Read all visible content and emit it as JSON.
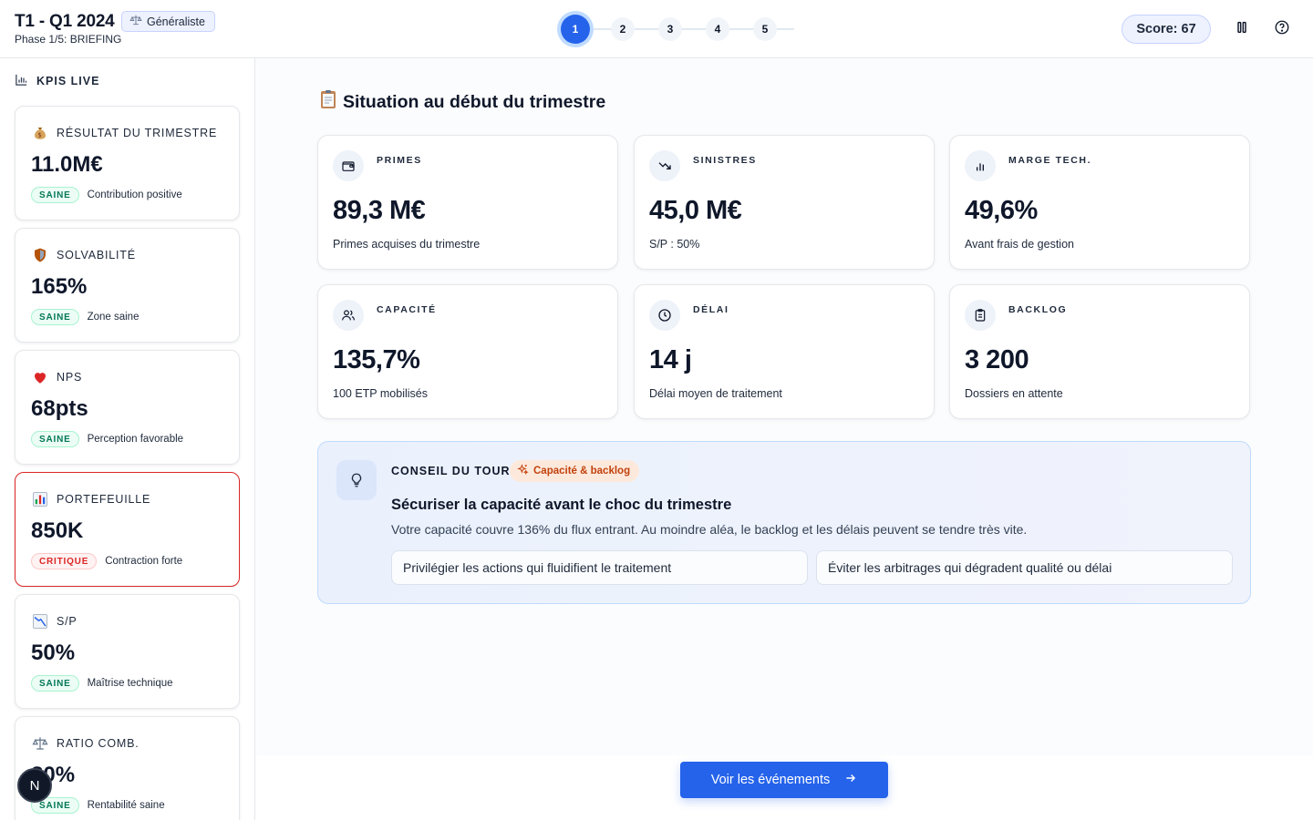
{
  "header": {
    "title": "T1 - Q1 2024",
    "profile_badge": "Généraliste",
    "phase": "Phase 1/5: BRIEFING",
    "steps": [
      "1",
      "2",
      "3",
      "4",
      "5"
    ],
    "active_step": 1,
    "score": "Score: 67"
  },
  "sidebar": {
    "title": "KPIS LIVE",
    "kpis": [
      {
        "icon": "money-bag-icon",
        "label": "RÉSULTAT DU TRIMESTRE",
        "value": "11.0M€",
        "status": "SAINE",
        "note": "Contribution positive"
      },
      {
        "icon": "shield-icon",
        "label": "SOLVABILITÉ",
        "value": "165%",
        "status": "SAINE",
        "note": "Zone saine"
      },
      {
        "icon": "heart-icon",
        "label": "NPS",
        "value": "68pts",
        "status": "SAINE",
        "note": "Perception favorable"
      },
      {
        "icon": "bar-chart-icon",
        "label": "PORTEFEUILLE",
        "value": "850K",
        "status": "CRITIQUE",
        "note": "Contraction forte"
      },
      {
        "icon": "chart-down-icon",
        "label": "S/P",
        "value": "50%",
        "status": "SAINE",
        "note": "Maîtrise technique"
      },
      {
        "icon": "balance-scale-icon",
        "label": "RATIO COMB.",
        "value": "80%",
        "status": "SAINE",
        "note": "Rentabilité saine"
      }
    ],
    "avatar_initial": "N"
  },
  "main": {
    "section_title": "Situation au début du trimestre",
    "metrics": [
      {
        "icon": "wallet-icon",
        "label": "PRIMES",
        "value": "89,3 M€",
        "sub": "Primes acquises du trimestre"
      },
      {
        "icon": "trend-down-icon",
        "label": "SINISTRES",
        "value": "45,0 M€",
        "sub": "S/P : 50%"
      },
      {
        "icon": "bar-chart-icon",
        "label": "MARGE TECH.",
        "value": "49,6%",
        "sub": "Avant frais de gestion"
      },
      {
        "icon": "users-icon",
        "label": "CAPACITÉ",
        "value": "135,7%",
        "sub": "100 ETP mobilisés"
      },
      {
        "icon": "clock-icon",
        "label": "DÉLAI",
        "value": "14 j",
        "sub": "Délai moyen de traitement"
      },
      {
        "icon": "clipboard-icon",
        "label": "BACKLOG",
        "value": "3 200",
        "sub": "Dossiers en attente"
      }
    ],
    "advice": {
      "label": "CONSEIL DU TOUR",
      "tag": "Capacité & backlog",
      "headline": "Sécuriser la capacité avant le choc du trimestre",
      "text": "Votre capacité couvre 136% du flux entrant. Au moindre aléa, le backlog et les délais peuvent se tendre très vite.",
      "pills": [
        "Privilégier les actions qui fluidifient le traitement",
        "Éviter les arbitrages qui dégradent qualité ou délai"
      ]
    },
    "cta": "Voir les événements"
  },
  "colors": {
    "accent": "#2563eb",
    "healthy": "#047857",
    "critical": "#dc2626",
    "tag": "#c2410c"
  }
}
